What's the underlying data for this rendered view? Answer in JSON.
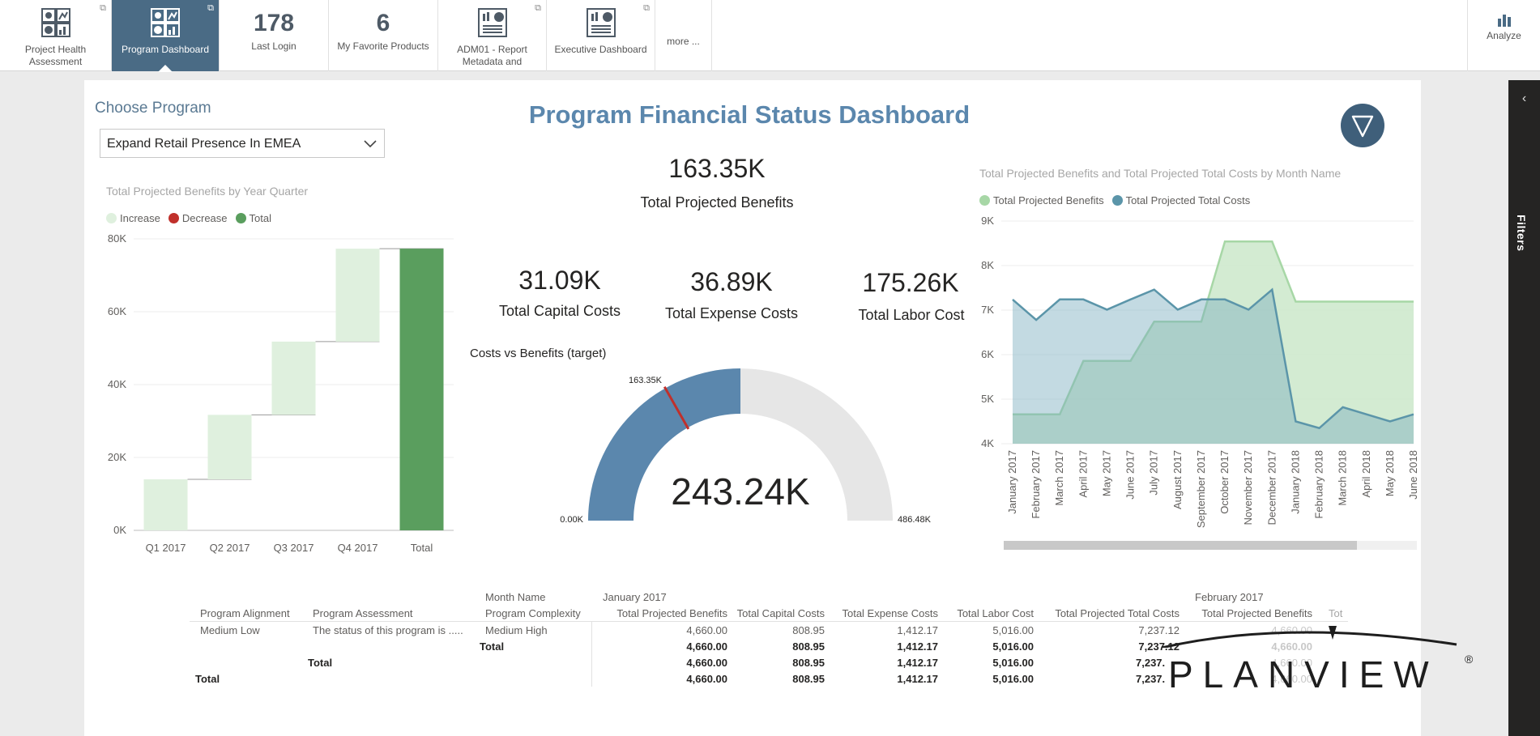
{
  "topbar": {
    "tiles": [
      {
        "label": "Project Health Assessment",
        "icon": "dashboard-grid-icon"
      },
      {
        "label": "Program Dashboard",
        "icon": "dashboard-grid-icon"
      },
      {
        "number": "178",
        "label": "Last Login"
      },
      {
        "number": "6",
        "label": "My Favorite Products"
      },
      {
        "label": "ADM01 - Report Metadata and",
        "icon": "report-icon"
      },
      {
        "label": "Executive Dashboard",
        "icon": "report-icon"
      },
      {
        "label": "more ..."
      }
    ],
    "analyze_label": "Analyze",
    "colors": {
      "active_tile": "#4a6b85"
    }
  },
  "filters_pane": {
    "label": "Filters"
  },
  "report": {
    "title": "Program Financial Status Dashboard",
    "choose_program_label": "Choose Program",
    "selected_program": "Expand Retail Presence In EMEA",
    "kpis": {
      "benefits": {
        "value": "163.35K",
        "label": "Total Projected Benefits"
      },
      "capital": {
        "value": "31.09K",
        "label": "Total Capital Costs"
      },
      "expense": {
        "value": "36.89K",
        "label": "Total Expense Costs"
      },
      "labor": {
        "value": "175.26K",
        "label": "Total Labor Cost"
      }
    },
    "brand": "PLANVIEW",
    "brand_mark": "®"
  },
  "waterfall": {
    "title": "Total Projected Benefits by Year Quarter",
    "legend": [
      {
        "name": "Increase",
        "color": "#dff0de"
      },
      {
        "name": "Decrease",
        "color": "#c0302b"
      },
      {
        "name": "Total",
        "color": "#5a9e5e"
      }
    ]
  },
  "gauge": {
    "title": "Costs vs Benefits (target)",
    "value_label": "243.24K",
    "min_label": "0.00K",
    "max_label": "486.48K",
    "target_label": "163.35K"
  },
  "area": {
    "title": "Total Projected Benefits and Total Projected Total Costs by Month Name",
    "legend": [
      {
        "name": "Total Projected Benefits",
        "color": "#a7d7a6"
      },
      {
        "name": "Total Projected Total Costs",
        "color": "#5b95a9"
      }
    ]
  },
  "chart_data": [
    {
      "type": "bar",
      "subtype": "waterfall",
      "title": "Total Projected Benefits by Year Quarter",
      "categories": [
        "Q1 2017",
        "Q2 2017",
        "Q3 2017",
        "Q4 2017",
        "Total"
      ],
      "increments": [
        14000,
        17700,
        20100,
        25500
      ],
      "total": 77300,
      "yticks": [
        "0K",
        "20K",
        "40K",
        "60K",
        "80K"
      ],
      "ylim": [
        0,
        80000
      ],
      "legend_position": "top-left",
      "grid": true
    },
    {
      "type": "gauge",
      "title": "Costs vs Benefits (target)",
      "value": 243240,
      "min": 0,
      "max": 486480,
      "target": 163350,
      "colors": {
        "fill": "#5b87ad",
        "track": "#e6e6e6",
        "target": "#c0302b"
      }
    },
    {
      "type": "area",
      "title": "Total Projected Benefits and Total Projected Total Costs by Month Name",
      "x": [
        "January 2017",
        "February 2017",
        "March 2017",
        "April 2017",
        "May 2017",
        "June 2017",
        "July 2017",
        "August 2017",
        "September 2017",
        "October 2017",
        "November 2017",
        "December 2017",
        "January 2018",
        "February 2018",
        "March 2018",
        "April 2018",
        "May 2018",
        "June 2018"
      ],
      "series": [
        {
          "name": "Total Projected Benefits",
          "values": [
            4660,
            4660,
            4660,
            5860,
            5860,
            5860,
            6740,
            6740,
            6740,
            8540,
            8540,
            8540,
            7190,
            7190,
            7190,
            7190,
            7190,
            7190
          ]
        },
        {
          "name": "Total Projected Total Costs",
          "values": [
            7237,
            6780,
            7240,
            7240,
            7010,
            7240,
            7460,
            7010,
            7240,
            7240,
            7010,
            7460,
            4500,
            4350,
            4820,
            4660,
            4500,
            4660
          ]
        }
      ],
      "yticks": [
        "4K",
        "5K",
        "6K",
        "7K",
        "8K",
        "9K"
      ],
      "ylim": [
        4000,
        9000
      ],
      "legend_position": "top-left",
      "grid": true
    }
  ],
  "matrix": {
    "header_month_name": "Month Name",
    "header_months": [
      "January 2017",
      "February 2017"
    ],
    "col_headers": [
      "Program Alignment",
      "Program Assessment",
      "Program Complexity",
      "Total Projected Benefits",
      "Total Capital Costs",
      "Total Expense Costs",
      "Total Labor Cost",
      "Total Projected Total Costs",
      "Total Projected Benefits",
      "Tot"
    ],
    "row1": [
      "Medium Low",
      "The status of this program is .....",
      "Medium High",
      "4,660.00",
      "808.95",
      "1,412.17",
      "5,016.00",
      "7,237.12",
      "4,660.00"
    ],
    "row2": [
      "Total",
      "4,660.00",
      "808.95",
      "1,412.17",
      "5,016.00",
      "7,237.12",
      "4,660.00"
    ],
    "row3": [
      "Total",
      "4,660.00",
      "808.95",
      "1,412.17",
      "5,016.00",
      "7,237.",
      "4,660.00"
    ],
    "row4": [
      "Total",
      "4,660.00",
      "808.95",
      "1,412.17",
      "5,016.00",
      "7,237.",
      "4,660.00"
    ]
  }
}
